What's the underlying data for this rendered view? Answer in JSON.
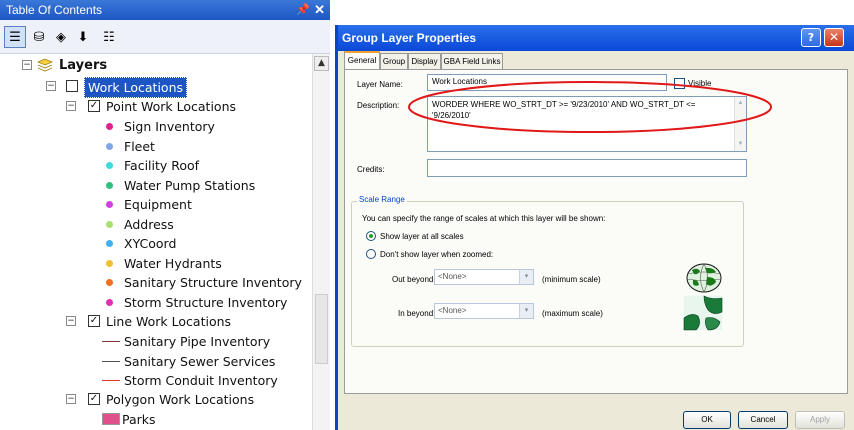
{
  "toc": {
    "title": "Table Of Contents",
    "pin_glyph": "x",
    "close_glyph": "✕",
    "toolbar": [
      {
        "icon": "list-by-drawing-order-icon",
        "glyph": "☰"
      },
      {
        "icon": "list-by-source-icon",
        "glyph": "⛁"
      },
      {
        "icon": "list-by-visibility-icon",
        "glyph": "◈"
      },
      {
        "icon": "list-by-selection-icon",
        "glyph": "⬇"
      },
      {
        "icon": "options-icon",
        "glyph": "☷"
      }
    ],
    "tree": {
      "root": {
        "label": "Layers",
        "expand_glyph": "−"
      },
      "group": {
        "label": "Work Locations",
        "expand_glyph": "−",
        "checked": false
      },
      "point_group": {
        "label": "Point Work Locations",
        "expand_glyph": "−",
        "check_glyph": "✓"
      },
      "point_layers": [
        {
          "label": "Sign Inventory",
          "color": "#e0208c"
        },
        {
          "label": "Fleet",
          "color": "#7ea6e8"
        },
        {
          "label": "Facility Roof",
          "color": "#3fd9d9"
        },
        {
          "label": "Water Pump Stations",
          "color": "#30c080"
        },
        {
          "label": "Equipment",
          "color": "#d040e0"
        },
        {
          "label": "Address",
          "color": "#a8e070"
        },
        {
          "label": "XYCoord",
          "color": "#40b0f0"
        },
        {
          "label": "Water Hydrants",
          "color": "#f0c030"
        },
        {
          "label": "Sanitary Structure Inventory",
          "color": "#f07020"
        },
        {
          "label": "Storm Structure Inventory",
          "color": "#e030b0"
        }
      ],
      "line_group": {
        "label": "Line Work Locations",
        "expand_glyph": "−",
        "check_glyph": "✓"
      },
      "line_layers": [
        {
          "label": "Sanitary Pipe Inventory",
          "color": "#7a3a3a"
        },
        {
          "label": "Sanitary Sewer Services",
          "color": "#505050"
        },
        {
          "label": "Storm Conduit Inventory",
          "color": "#e03030"
        }
      ],
      "polygon_group": {
        "label": "Polygon Work Locations",
        "expand_glyph": "−",
        "check_glyph": "✓"
      },
      "polygon_layers": [
        {
          "label": "Parks",
          "color": "#e0508a"
        }
      ]
    },
    "scroll_up_glyph": "▲"
  },
  "dialog": {
    "title": "Group Layer Properties",
    "help_glyph": "?",
    "close_glyph": "✕",
    "tabs": [
      {
        "label": "General",
        "active": true
      },
      {
        "label": "Group",
        "active": false
      },
      {
        "label": "Display",
        "active": false
      },
      {
        "label": "GBA Field Links",
        "active": false
      }
    ],
    "general": {
      "layer_name_label": "Layer Name:",
      "layer_name_value": "Work Locations",
      "visible_label": "Visible",
      "visible_checked": false,
      "description_label": "Description:",
      "description_value": "WORDER WHERE WO_STRT_DT >= '9/23/2010' AND WO_STRT_DT <= '9/26/2010'",
      "credits_label": "Credits:",
      "credits_value": "",
      "scale_range": {
        "legend": "Scale Range",
        "instruction": "You can specify the range of scales at which this layer will be shown:",
        "show_all_label": "Show layer at all scales",
        "show_all_selected": true,
        "dont_show_label": "Don't show layer when zoomed:",
        "out_beyond_label": "Out beyond:",
        "out_beyond_value": "<None>",
        "out_beyond_hint": "(minimum scale)",
        "in_beyond_label": "In beyond:",
        "in_beyond_value": "<None>",
        "in_beyond_hint": "(maximum scale)",
        "combo_arrow_glyph": "▾",
        "scroll_up_glyph": "▲",
        "scroll_down_glyph": "▼"
      }
    },
    "buttons": {
      "ok": "OK",
      "cancel": "Cancel",
      "apply": "Apply",
      "apply_enabled": false
    }
  },
  "colors": {
    "annotation": "#e01818",
    "selection": "#1d56c2",
    "titlebar": "#0a48d8"
  }
}
